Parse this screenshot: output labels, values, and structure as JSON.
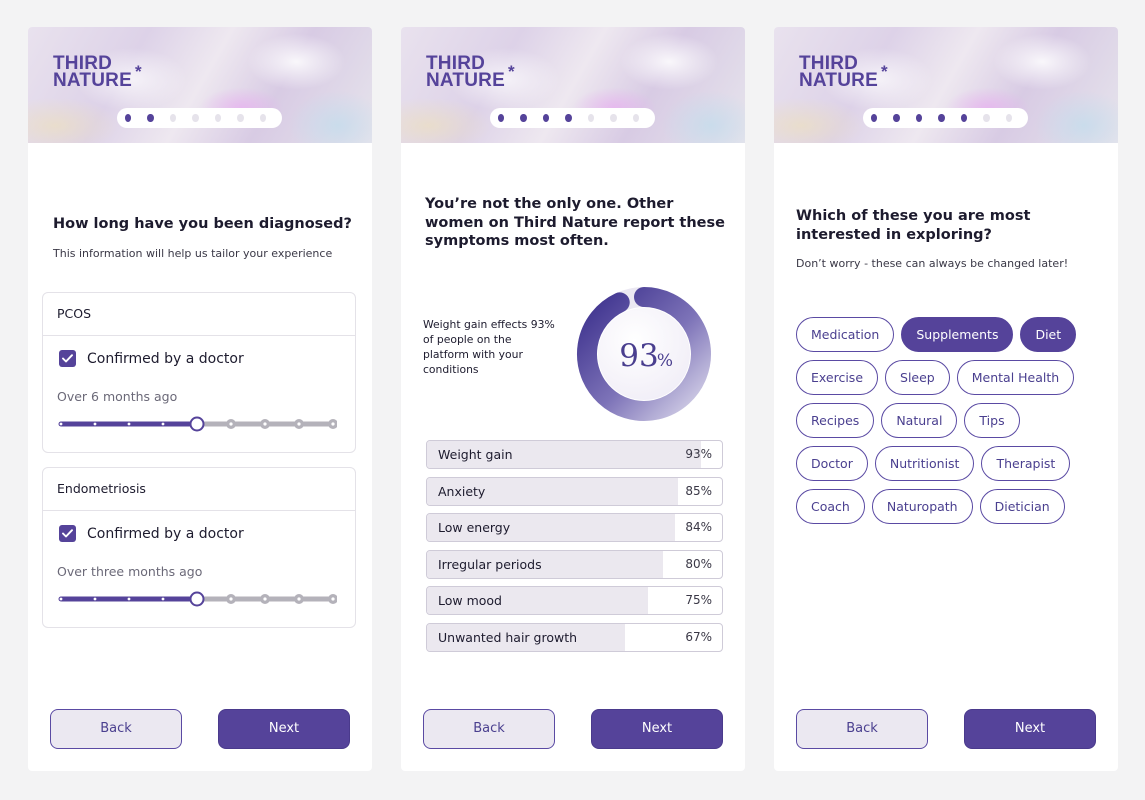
{
  "brand": {
    "line1": "THIRD",
    "line2": "NATURE",
    "star": "*"
  },
  "colors": {
    "accent": "#55439a",
    "track": "#b4b2ba",
    "surface": "#ebe8f1"
  },
  "screens": [
    {
      "progress": {
        "total": 7,
        "active": 2
      },
      "title": "How long have you been diagnosed?",
      "subtitle": "This information will help us tailor your experience",
      "conditions": [
        {
          "name": "PCOS",
          "check_label": "Confirmed by a doctor",
          "checked": true,
          "period": "Over 6 months ago",
          "slider": {
            "steps": 9,
            "value_index": 4
          }
        },
        {
          "name": "Endometriosis",
          "check_label": "Confirmed by a doctor",
          "checked": true,
          "period": "Over three months ago",
          "slider": {
            "steps": 9,
            "value_index": 4
          }
        }
      ],
      "back_label": "Back",
      "next_label": "Next"
    },
    {
      "progress": {
        "total": 7,
        "active": 4
      },
      "title": "You’re not the only one. Other women on Third Nature report these symptoms most often.",
      "stat_text": "Weight gain effects 93% of people on the platform with your conditions",
      "donut": {
        "value": 93,
        "number": "93",
        "unit": "%"
      },
      "symptoms": [
        {
          "label": "Weight gain",
          "percent": 93,
          "display": "93%"
        },
        {
          "label": "Anxiety",
          "percent": 85,
          "display": "85%"
        },
        {
          "label": "Low energy",
          "percent": 84,
          "display": "84%"
        },
        {
          "label": "Irregular periods",
          "percent": 80,
          "display": "80%"
        },
        {
          "label": "Low mood",
          "percent": 75,
          "display": "75%"
        },
        {
          "label": "Unwanted hair growth",
          "percent": 67,
          "display": "67%"
        }
      ],
      "back_label": "Back",
      "next_label": "Next"
    },
    {
      "progress": {
        "total": 7,
        "active": 5
      },
      "title": "Which of these you are most interested in exploring?",
      "subtitle": "Don’t worry - these can always be changed later!",
      "interest_rows": [
        [
          {
            "label": "Medication",
            "selected": false
          },
          {
            "label": "Supplements",
            "selected": true
          },
          {
            "label": "Diet",
            "selected": true
          }
        ],
        [
          {
            "label": "Exercise",
            "selected": false
          },
          {
            "label": "Sleep",
            "selected": false
          },
          {
            "label": "Mental Health",
            "selected": false
          }
        ],
        [
          {
            "label": "Recipes",
            "selected": false
          },
          {
            "label": "Natural",
            "selected": false
          },
          {
            "label": "Tips",
            "selected": false
          }
        ],
        [
          {
            "label": "Doctor",
            "selected": false
          },
          {
            "label": "Nutritionist",
            "selected": false
          },
          {
            "label": "Therapist",
            "selected": false
          }
        ],
        [
          {
            "label": "Coach",
            "selected": false
          },
          {
            "label": "Naturopath",
            "selected": false
          },
          {
            "label": "Dietician",
            "selected": false
          }
        ]
      ],
      "back_label": "Back",
      "next_label": "Next"
    }
  ]
}
